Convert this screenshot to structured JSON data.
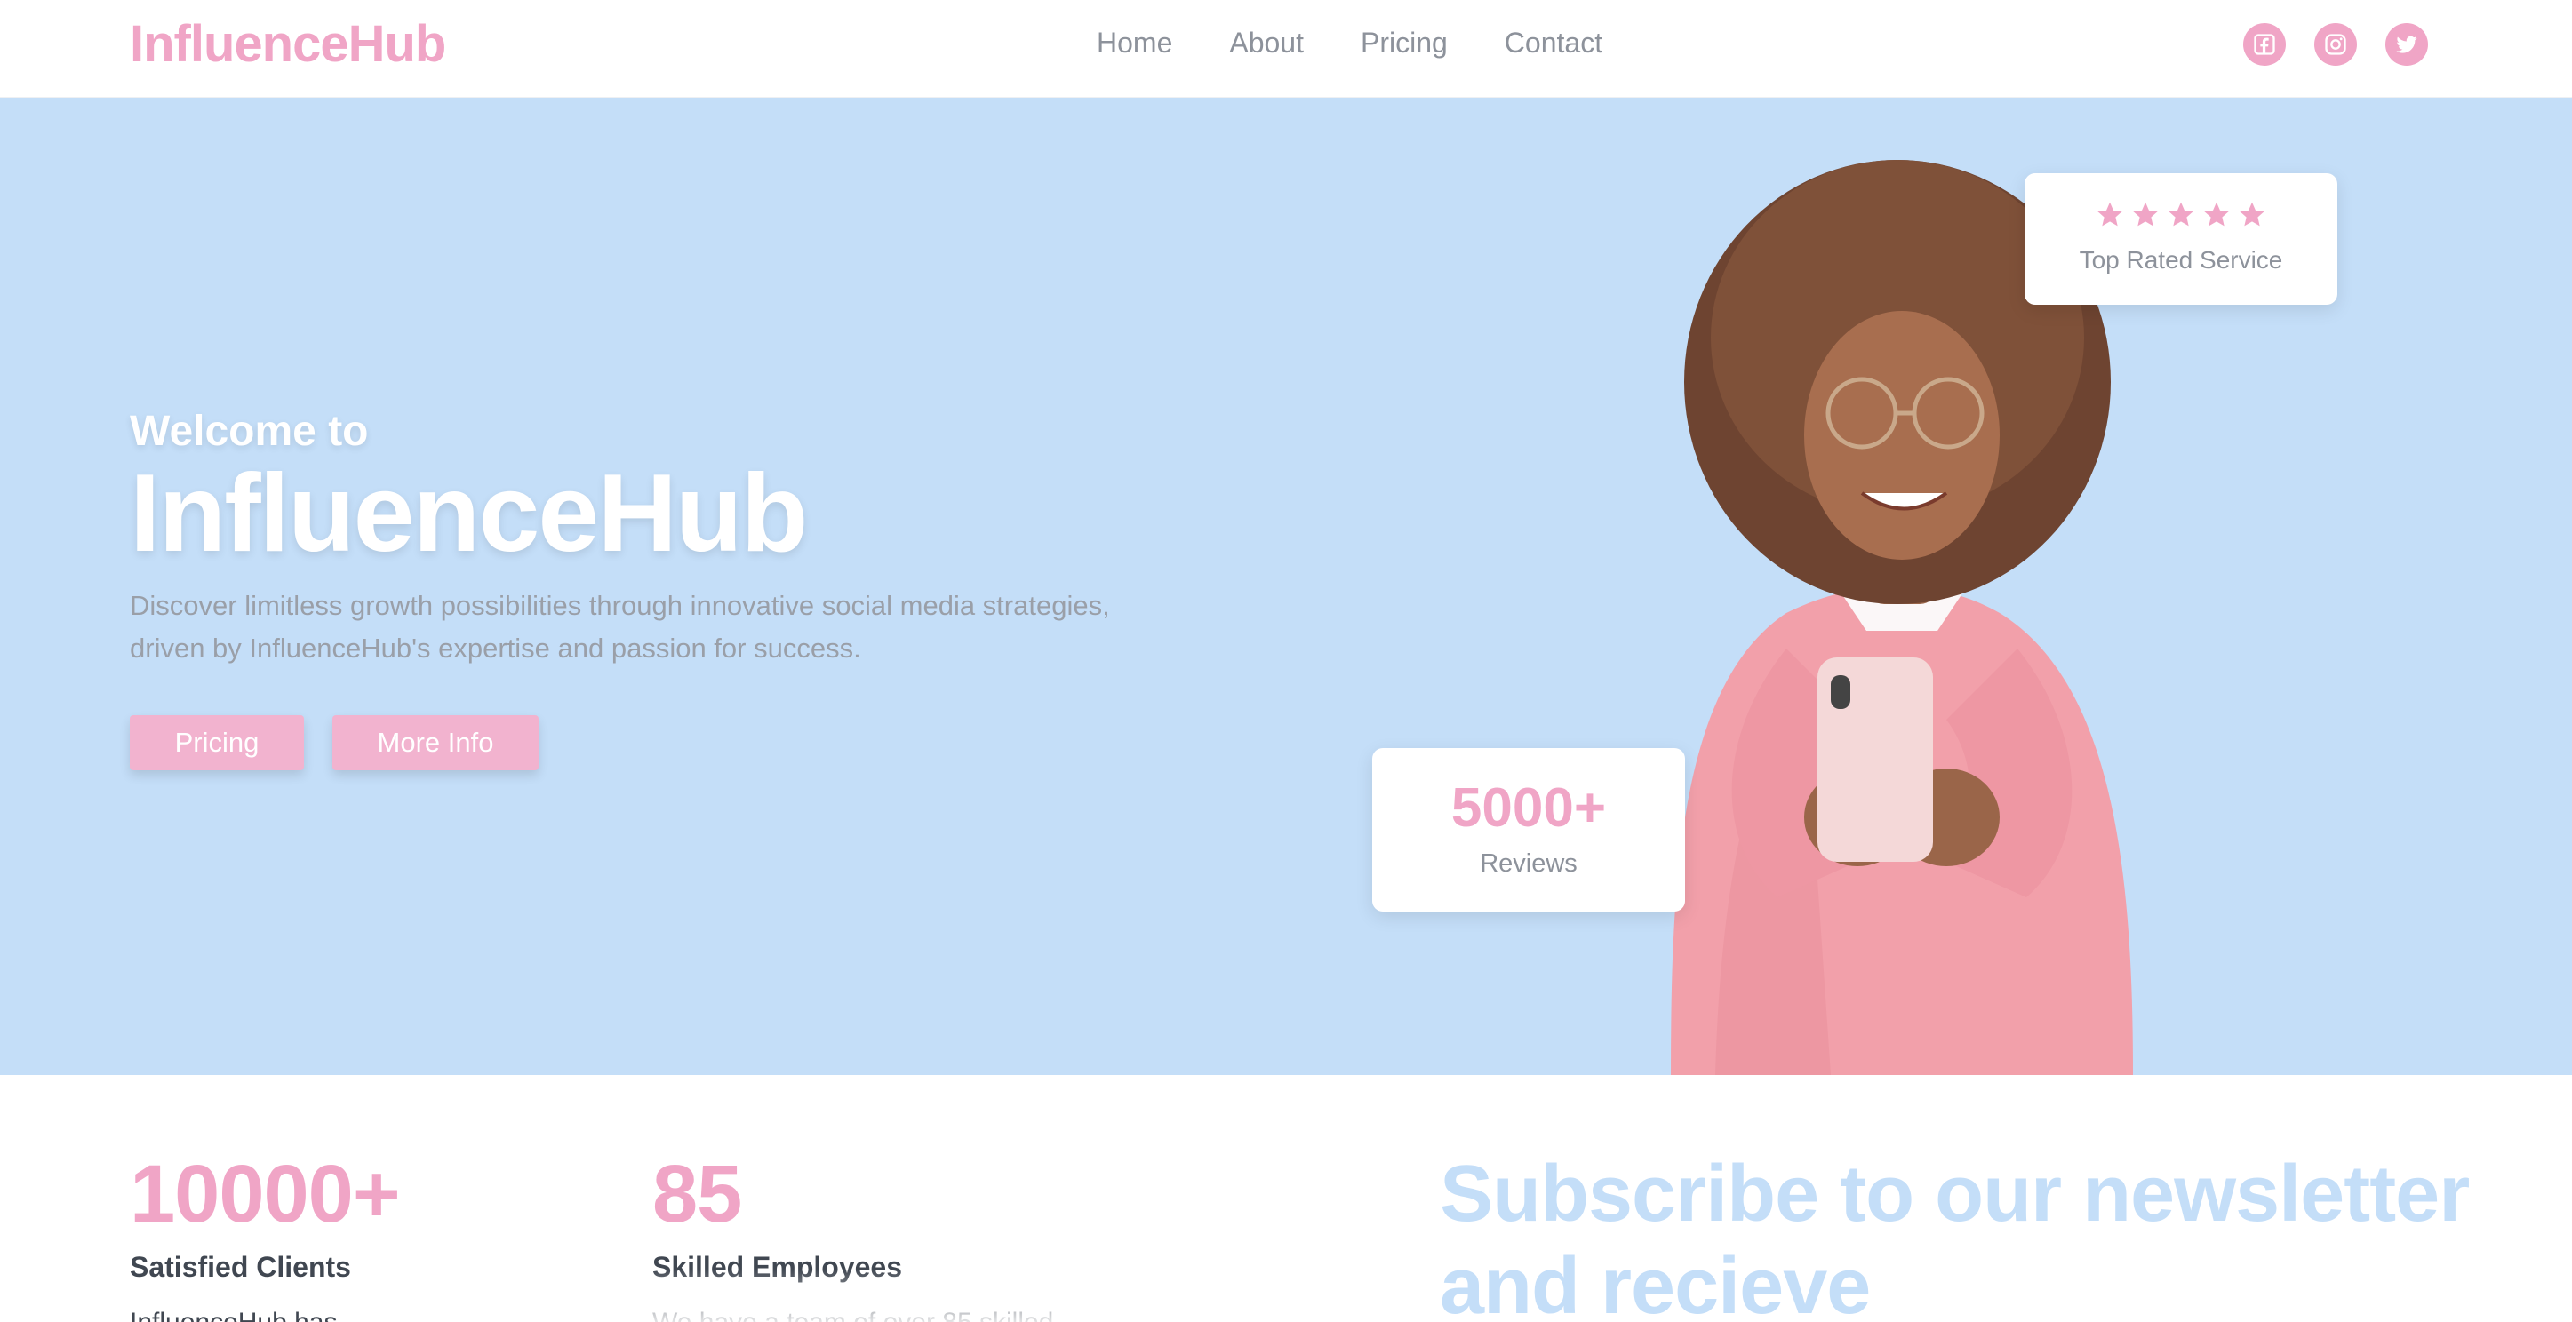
{
  "nav": {
    "logo": "InfluenceHub",
    "links": [
      "Home",
      "About",
      "Pricing",
      "Contact"
    ],
    "socials": [
      "facebook-icon",
      "instagram-icon",
      "twitter-icon"
    ]
  },
  "hero": {
    "welcome": "Welcome to",
    "title": "InfluenceHub",
    "description_line1": "Discover limitless growth possibilities through innovative social media strategies,",
    "description_line2": "driven by InfluenceHub's expertise and passion for success.",
    "buttons": {
      "pricing": "Pricing",
      "more_info": "More Info"
    },
    "rating_card": {
      "stars": 5,
      "label": "Top Rated Service"
    },
    "reviews_card": {
      "count": "5000+",
      "label": "Reviews"
    }
  },
  "stats": [
    {
      "number": "10000+",
      "label": "Satisfied Clients",
      "desc": "InfluenceHub has ..."
    },
    {
      "number": "85",
      "label": "Skilled Employees",
      "desc": "We have a team of over 85 skilled ..."
    }
  ],
  "newsletter": {
    "headline": "Subscribe to our newsletter and recieve"
  },
  "colors": {
    "brand_pink": "#f0a5c6",
    "hero_blue": "#c4def8",
    "text_gray": "#8d929b",
    "text_dark": "#404751"
  }
}
